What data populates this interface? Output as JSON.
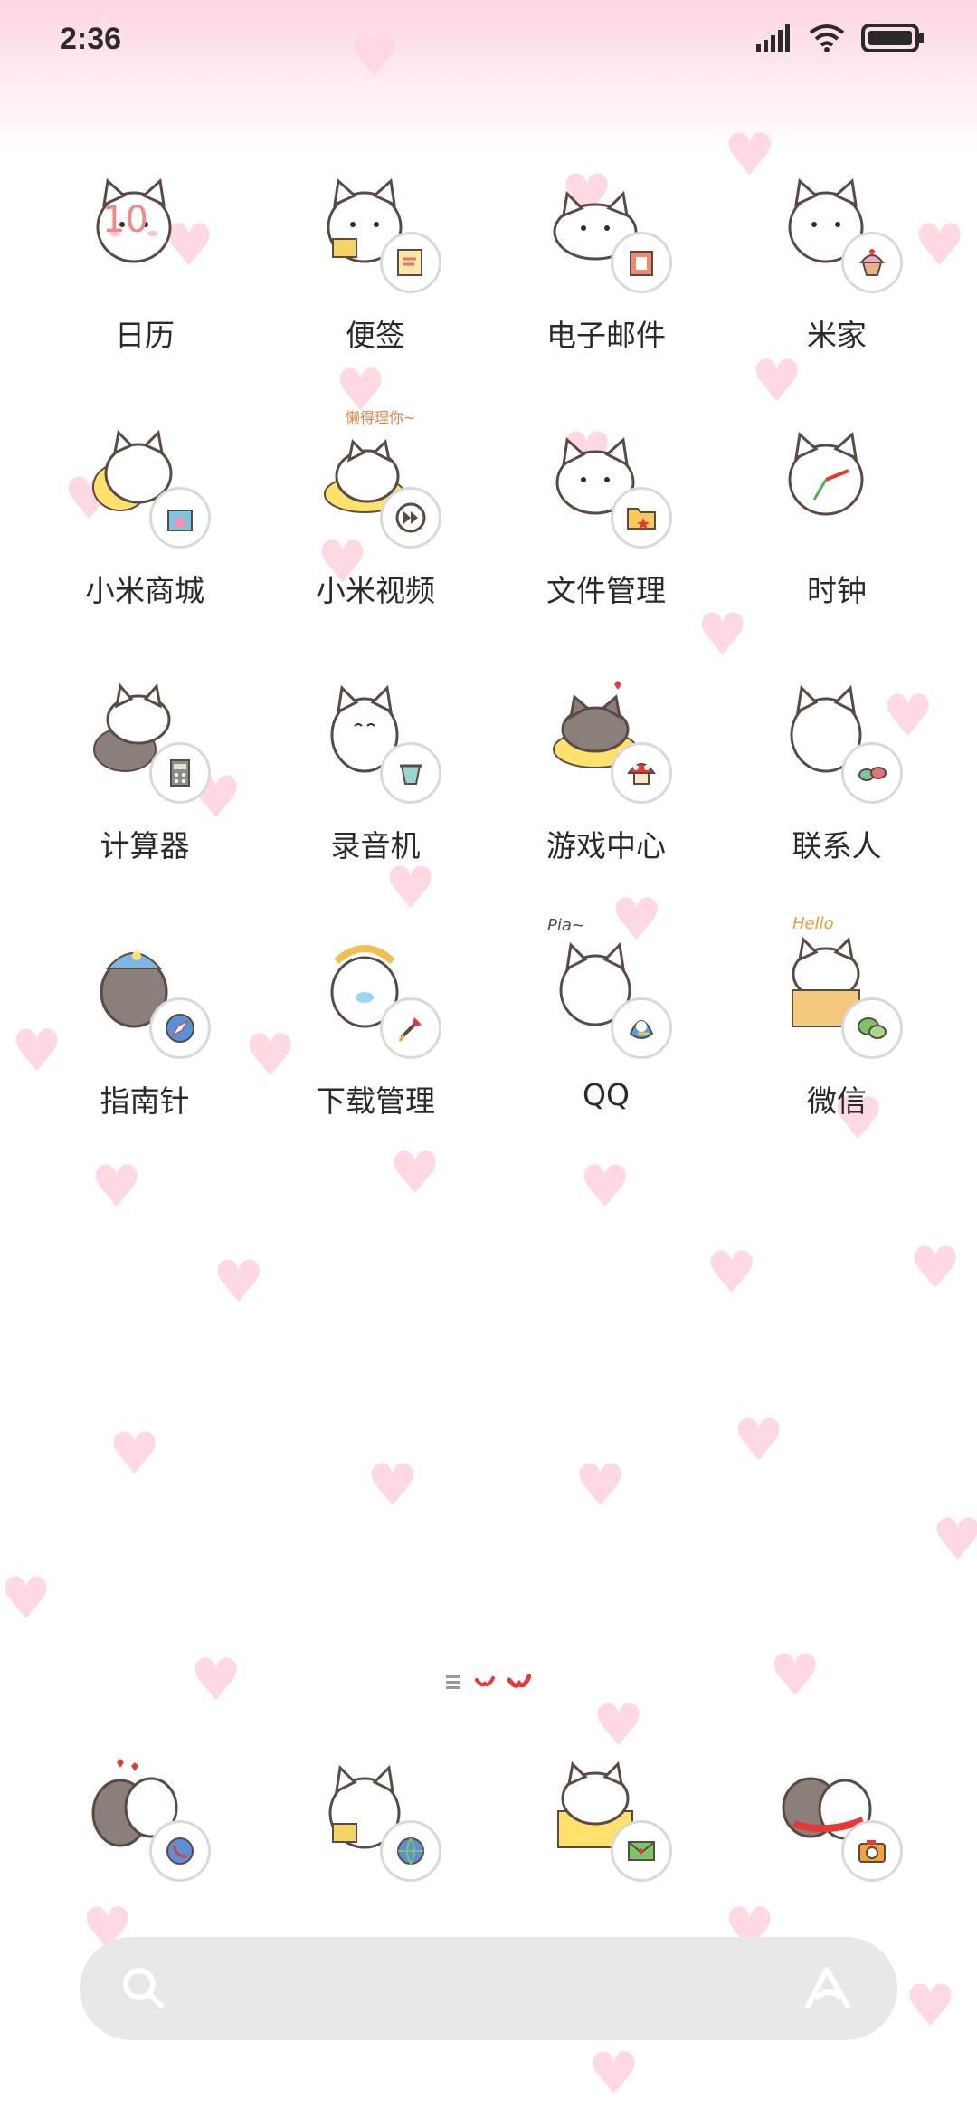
{
  "status_bar": {
    "time": "2:36",
    "icons": [
      "signal-icon",
      "wifi-icon",
      "battery-icon"
    ]
  },
  "apps": [
    {
      "label": "日历",
      "badge_icon": "calendar-icon",
      "badge_text": "10"
    },
    {
      "label": "便签",
      "badge_icon": "notes-icon"
    },
    {
      "label": "电子邮件",
      "badge_icon": "mail-icon"
    },
    {
      "label": "米家",
      "badge_icon": "cupcake-icon"
    },
    {
      "label": "小米商城",
      "badge_icon": "store-icon"
    },
    {
      "label": "小米视频",
      "badge_icon": "video-icon",
      "caption": "懒得理你~"
    },
    {
      "label": "文件管理",
      "badge_icon": "folder-icon"
    },
    {
      "label": "时钟",
      "badge_icon": "clock-icon"
    },
    {
      "label": "计算器",
      "badge_icon": "calculator-icon"
    },
    {
      "label": "录音机",
      "badge_icon": "recorder-icon"
    },
    {
      "label": "游戏中心",
      "badge_icon": "game-icon"
    },
    {
      "label": "联系人",
      "badge_icon": "contacts-icon"
    },
    {
      "label": "指南针",
      "badge_icon": "compass-icon"
    },
    {
      "label": "下载管理",
      "badge_icon": "download-icon"
    },
    {
      "label": "QQ",
      "badge_icon": "qq-icon",
      "caption": "Pia~"
    },
    {
      "label": "微信",
      "badge_icon": "wechat-icon",
      "caption": "Hello"
    }
  ],
  "dock": [
    {
      "badge_icon": "phone-icon"
    },
    {
      "badge_icon": "browser-icon"
    },
    {
      "badge_icon": "messages-icon"
    },
    {
      "badge_icon": "camera-icon"
    }
  ],
  "page_indicator": {
    "icons": [
      "menu-lines-icon",
      "heart-page-icon",
      "heart-page-icon"
    ]
  },
  "search_bar": {
    "placeholder": ""
  },
  "colors": {
    "top_gradient": "#ffd6e0",
    "label_text": "#2a2a2a",
    "heart": "#ffd9e2",
    "search_bg": "#e8e8e8",
    "accent_red": "#e53935"
  }
}
